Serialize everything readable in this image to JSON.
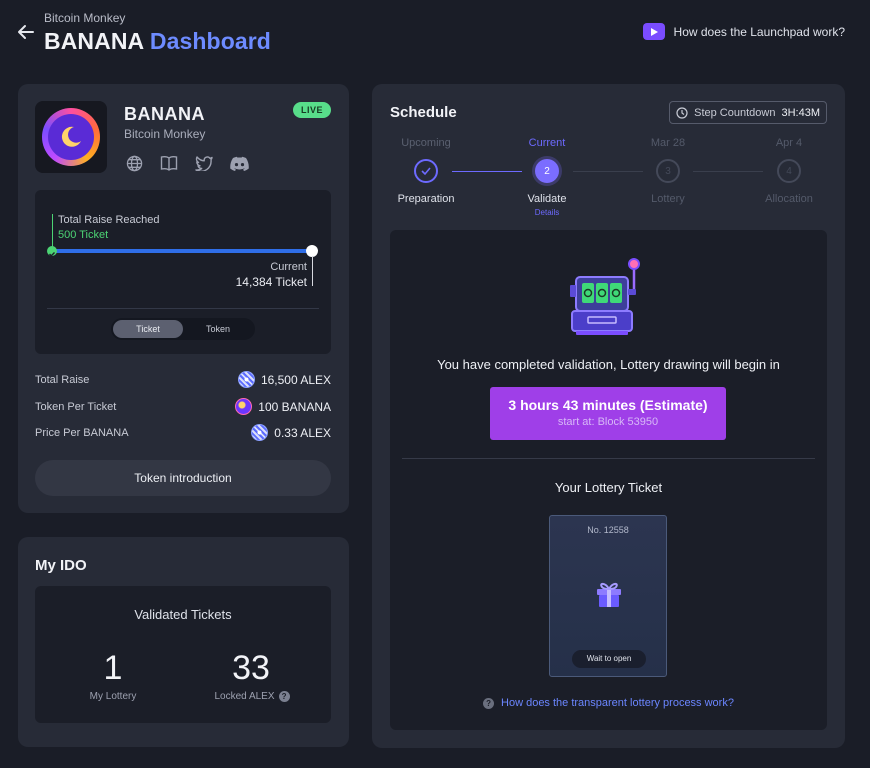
{
  "header": {
    "breadcrumb": "Bitcoin Monkey",
    "title_main": "BANANA",
    "title_accent": "Dashboard",
    "help_link": "How does the Launchpad work?"
  },
  "project": {
    "name": "BANANA",
    "subtitle": "Bitcoin Monkey",
    "status": "LIVE",
    "social_icons": [
      "globe-icon",
      "book-icon",
      "twitter-icon",
      "discord-icon"
    ],
    "raise": {
      "reached_label": "Total Raise Reached",
      "reached_value": "500 Ticket",
      "current_label": "Current",
      "current_value": "14,384 Ticket",
      "progress": 1.0
    },
    "toggle": {
      "options": [
        "Ticket",
        "Token"
      ],
      "selected": "Ticket"
    },
    "stats": [
      {
        "label": "Total Raise",
        "value": "16,500 ALEX",
        "coin": "alex"
      },
      {
        "label": "Token Per Ticket",
        "value": "100 BANANA",
        "coin": "banana"
      },
      {
        "label": "Price Per BANANA",
        "value": "0.33 ALEX",
        "coin": "alex"
      }
    ],
    "intro_button": "Token introduction"
  },
  "ido": {
    "title": "My IDO",
    "heading": "Validated Tickets",
    "my_lottery_value": "1",
    "my_lottery_label": "My Lottery",
    "locked_value": "33",
    "locked_label": "Locked ALEX"
  },
  "schedule": {
    "title": "Schedule",
    "countdown_label": "Step Countdown",
    "countdown_value": "3H:43M",
    "steps": [
      {
        "top": "Upcoming",
        "number": "",
        "label": "Preparation",
        "state": "done"
      },
      {
        "top": "Current",
        "number": "2",
        "label": "Validate",
        "state": "active"
      },
      {
        "top": "Mar 28",
        "number": "3",
        "label": "Lottery",
        "state": "pending"
      },
      {
        "top": "Apr 4",
        "number": "4",
        "label": "Allocation",
        "state": "pending"
      }
    ],
    "details_link": "Details",
    "message": "You have completed validation, Lottery drawing will begin in",
    "cta_main": "3 hours 43 minutes (Estimate)",
    "cta_sub": "start at: Block 53950",
    "ticket_title": "Your Lottery Ticket",
    "ticket_no": "No. 12558",
    "ticket_status": "Wait to open",
    "lottery_help": "How does the transparent lottery process work?"
  },
  "colors": {
    "background": "#1a1d27",
    "card": "#272b37",
    "accent_blue": "#6d8bff",
    "accent_purple": "#9f3fe8",
    "live_green": "#58dd8a"
  }
}
